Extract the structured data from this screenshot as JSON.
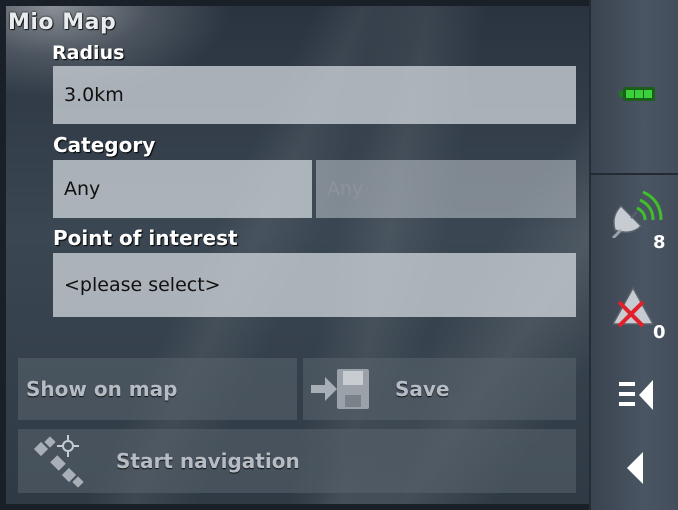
{
  "app": {
    "title": "Mio Map"
  },
  "form": {
    "radius_label": "Radius",
    "radius_value": "3.0km",
    "category_label": "Category",
    "category_value": "Any",
    "subcategory_value": "Any",
    "poi_label": "Point of interest",
    "poi_value": "<please select>"
  },
  "actions": {
    "show_on_map": "Show on map",
    "save": "Save",
    "start_navigation": "Start navigation"
  },
  "status": {
    "satellites_count": "8",
    "alerts_count": "0"
  },
  "icons": {
    "battery": "battery-icon",
    "satellite": "satellite-signal-icon",
    "alert": "alert-off-icon",
    "menu": "menu-icon",
    "back": "back-icon",
    "save": "save-disk-icon",
    "navigation": "satellite-navigation-icon"
  },
  "colors": {
    "battery": "#3bd13b",
    "signal": "#3fbf2a",
    "alert_x": "#e0202a"
  }
}
